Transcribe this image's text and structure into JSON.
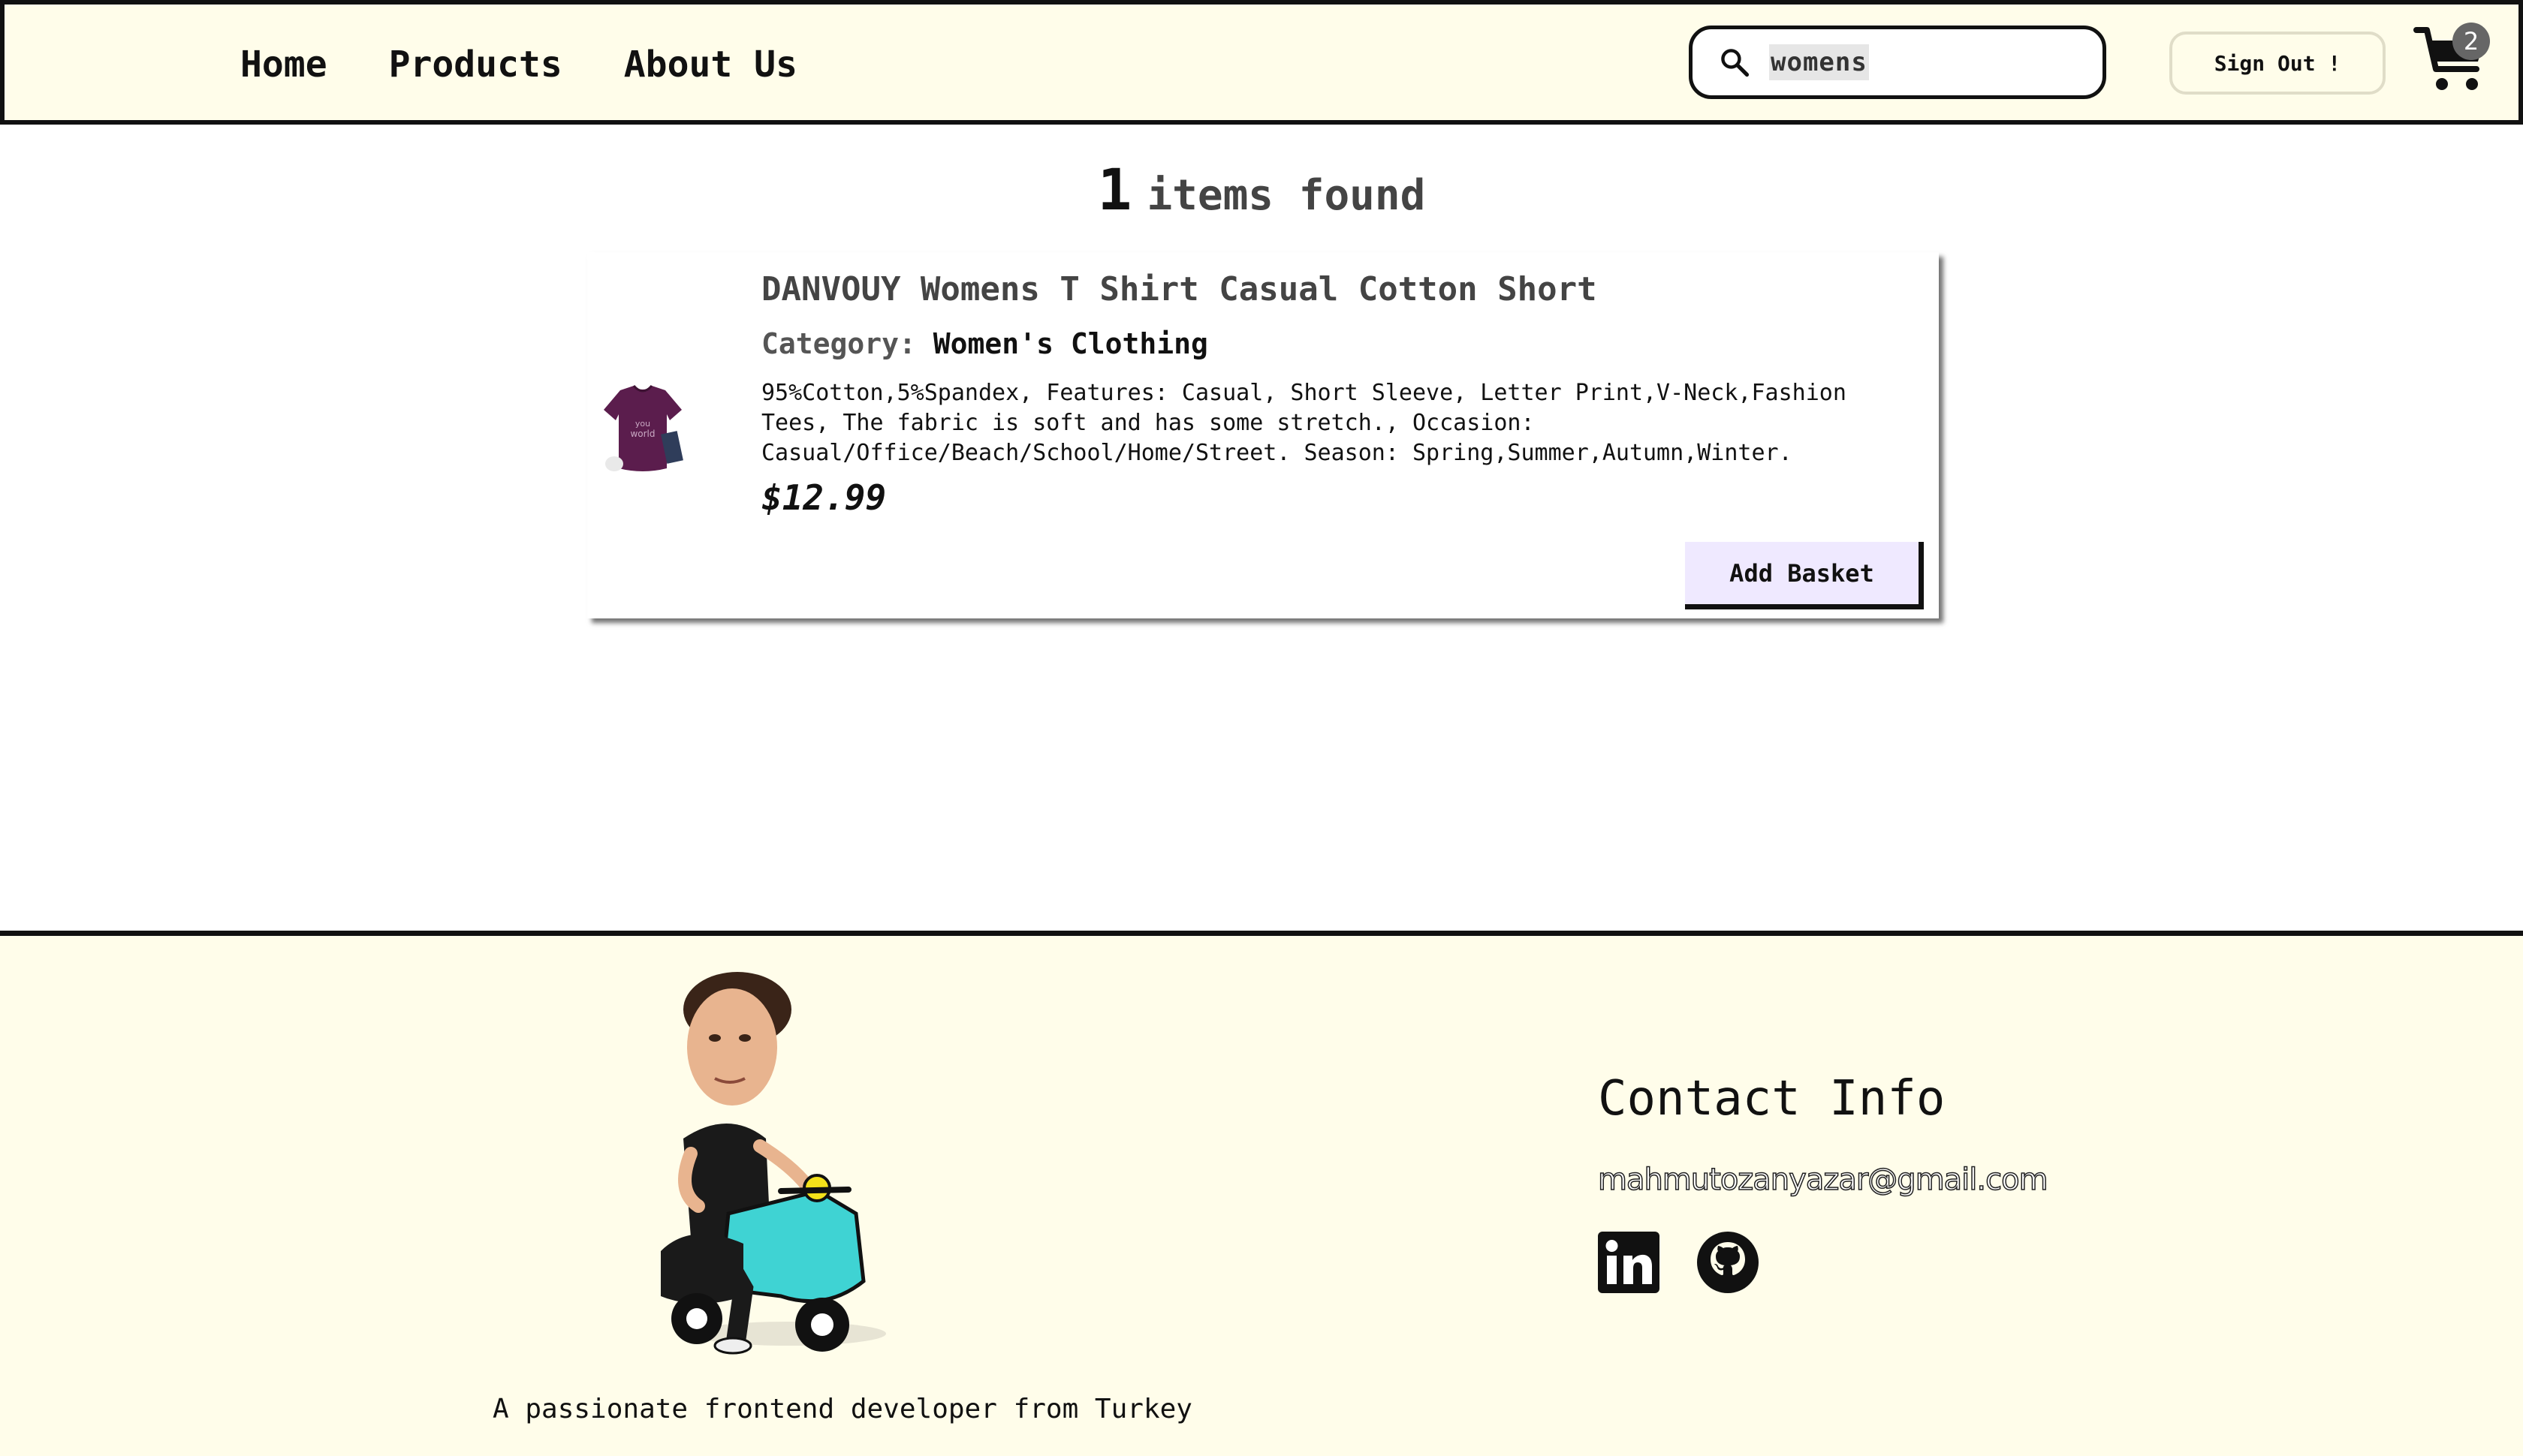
{
  "header": {
    "nav": [
      {
        "label": "Home"
      },
      {
        "label": "Products"
      },
      {
        "label": "About Us"
      }
    ],
    "search": {
      "value": "womens",
      "icon": "search-icon"
    },
    "sign_out_label": "Sign Out !",
    "cart": {
      "icon": "cart-icon",
      "count": "2"
    }
  },
  "results": {
    "count": "1",
    "label": "items found"
  },
  "product": {
    "title": "DANVOUY Womens T Shirt Casual Cotton Short",
    "category_label": "Category:",
    "category_value": "Women's Clothing",
    "description": "95%Cotton,5%Spandex, Features: Casual, Short Sleeve, Letter Print,V-Neck,Fashion Tees, The fabric is soft and has some stretch., Occasion: Casual/Office/Beach/School/Home/Street. Season: Spring,Summer,Autumn,Winter.",
    "price": "$12.99",
    "add_label": "Add Basket",
    "image_color": "#5b1d4d"
  },
  "footer": {
    "tagline": "A passionate frontend developer from Turkey",
    "contact_title": "Contact Info",
    "email": "mahmutozanyazar@gmail.com",
    "social": [
      {
        "icon": "linkedin-icon"
      },
      {
        "icon": "github-icon"
      }
    ]
  },
  "colors": {
    "header_bg": "#fffdea",
    "footer_bg": "#fffdea",
    "button_bg": "#efe9ff"
  }
}
